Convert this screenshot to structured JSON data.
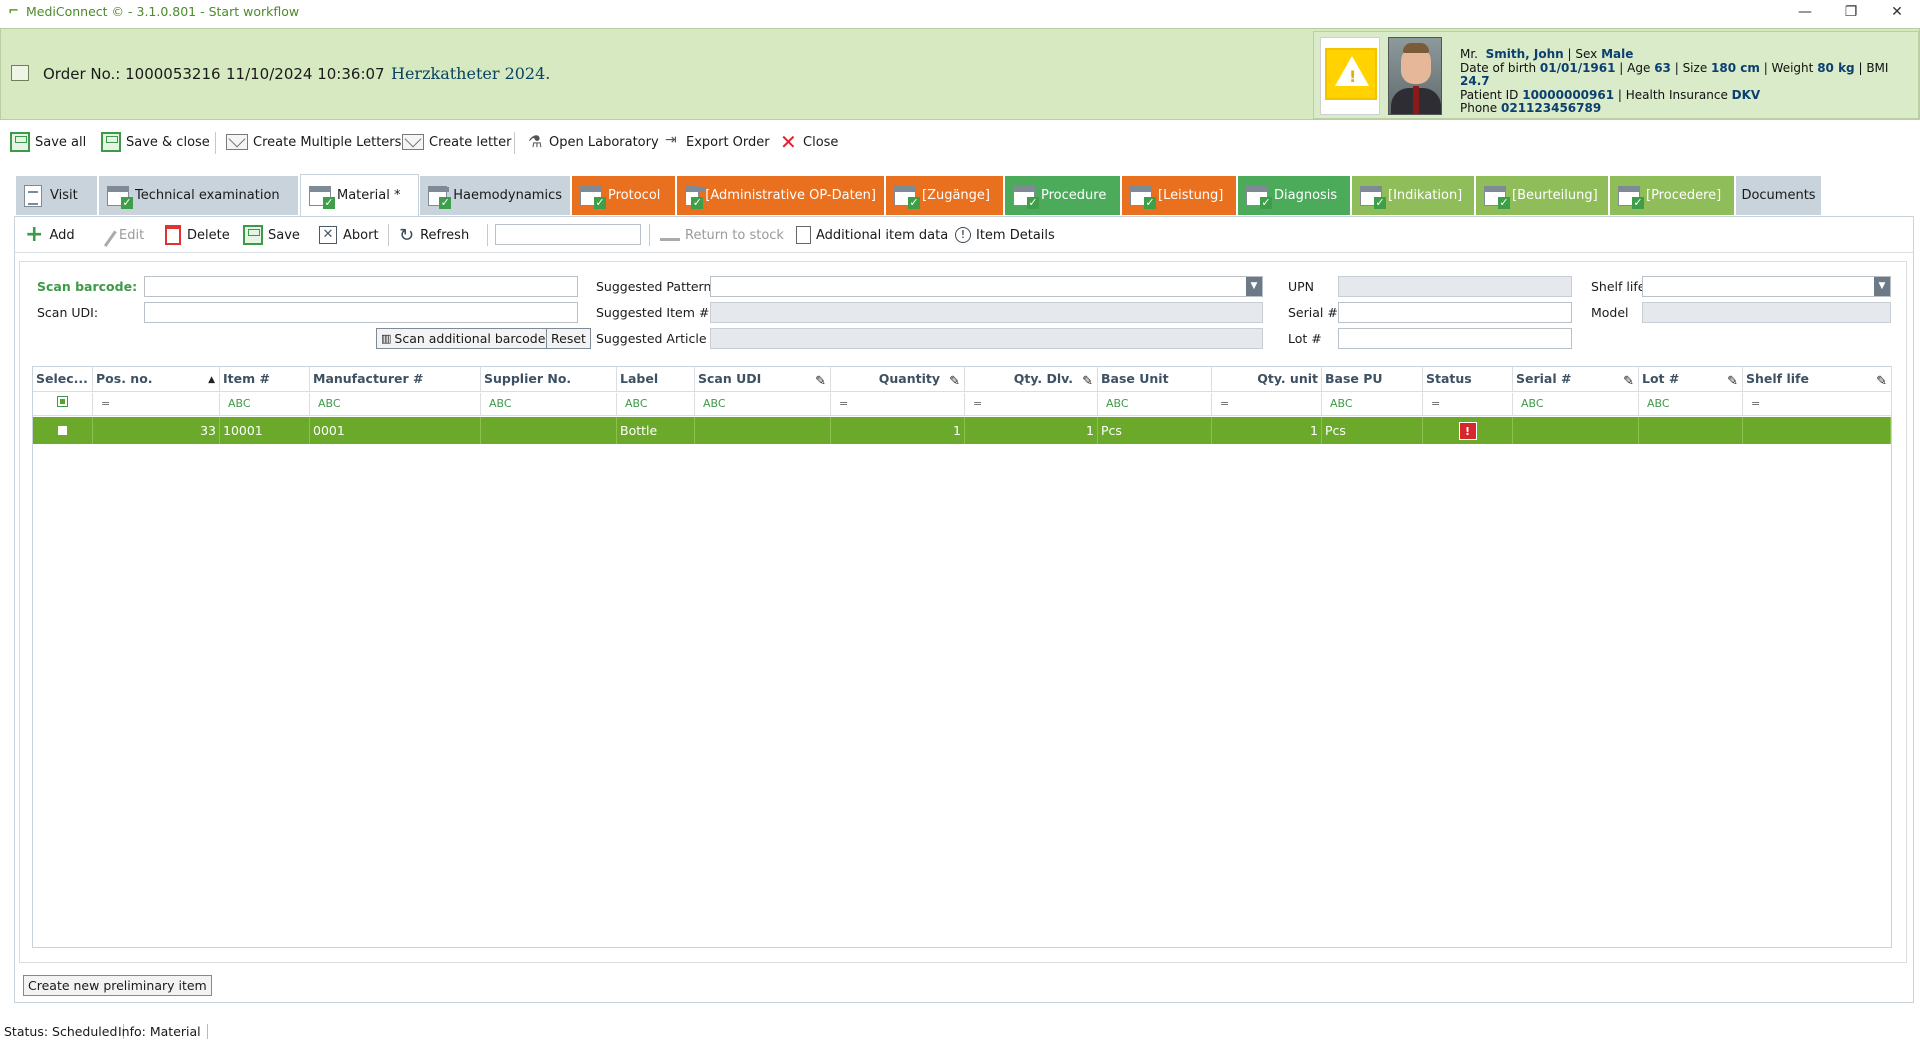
{
  "window": {
    "title": "MediConnect © - 3.1.0.801 - Start workflow",
    "controls": {
      "minimize": "—",
      "restore": "❐",
      "close": "✕"
    }
  },
  "header": {
    "order_label": "Order No.: 1000053216",
    "datetime": "11/10/2024 10:36:07",
    "workflow": "Herzkatheter 2024."
  },
  "patient": {
    "warning_icon": "warning-triangle-icon",
    "title": "Mr.",
    "name": "Smith, John",
    "sex_label": "Sex",
    "sex": "Male",
    "dob_label": "Date of birth",
    "dob": "01/01/1961",
    "age_label": "Age",
    "age": "63",
    "size_label": "Size",
    "size": "180 cm",
    "weight_label": "Weight",
    "weight": "80 kg",
    "bmi_label": "BMI",
    "bmi": "24.7",
    "pid_label": "Patient ID",
    "pid": "10000000961",
    "insurance_label": "Health Insurance",
    "insurance": "DKV",
    "phone_label": "Phone",
    "phone": "021123456789"
  },
  "toolbar": {
    "save_all": "Save all",
    "save_close": "Save & close",
    "create_multiple_letters": "Create Multiple Letters",
    "create_letter": "Create letter",
    "open_laboratory": "Open Laboratory",
    "export_order": "Export Order",
    "close": "Close"
  },
  "tabs": [
    {
      "label": "Visit",
      "style": "gray"
    },
    {
      "label": "Technical examination",
      "style": "gray"
    },
    {
      "label": "Material *",
      "style": "active"
    },
    {
      "label": "Haemodynamics",
      "style": "gray"
    },
    {
      "label": "Protocol",
      "style": "orange"
    },
    {
      "label": "[Administrative OP-Daten]",
      "style": "orange"
    },
    {
      "label": "[Zugänge]",
      "style": "orange"
    },
    {
      "label": "Procedure",
      "style": "green"
    },
    {
      "label": "[Leistung]",
      "style": "orange"
    },
    {
      "label": "Diagnosis",
      "style": "green"
    },
    {
      "label": "[Indikation]",
      "style": "olive"
    },
    {
      "label": "[Beurteilung]",
      "style": "olive"
    },
    {
      "label": "[Procedere]",
      "style": "olive"
    },
    {
      "label": "Documents",
      "style": "gray"
    }
  ],
  "subtoolbar": {
    "add": "Add",
    "edit": "Edit",
    "delete": "Delete",
    "save": "Save",
    "abort": "Abort",
    "refresh": "Refresh",
    "search_value": "",
    "return_to_stock": "Return to stock",
    "additional_item_data": "Additional item data",
    "item_details": "Item Details"
  },
  "form": {
    "scan_barcode_label": "Scan barcode:",
    "scan_udi_label": "Scan UDI:",
    "scan_additional_barcode": "Scan additional barcode",
    "reset": "Reset",
    "suggested_pattern_label": "Suggested Pattern",
    "suggested_item_label": "Suggested Item #",
    "suggested_article_label": "Suggested Article",
    "upn_label": "UPN",
    "serial_label": "Serial #",
    "lot_label": "Lot #",
    "shelf_life_label": "Shelf life",
    "model_label": "Model"
  },
  "grid": {
    "columns": [
      "Selec...",
      "Pos. no.",
      "Item #",
      "Manufacturer #",
      "Supplier No.",
      "Label",
      "Scan UDI",
      "Quantity",
      "Qty. Dlv.",
      "Base Unit",
      "Qty. unit",
      "Base PU",
      "Status",
      "Serial #",
      "Lot #",
      "Shelf life"
    ],
    "filters": [
      "",
      "=",
      "ABC",
      "ABC",
      "ABC",
      "ABC",
      "ABC",
      "=",
      "=",
      "ABC",
      "=",
      "ABC",
      "=",
      "ABC",
      "ABC",
      "="
    ],
    "rows": [
      {
        "selected": false,
        "pos": "33",
        "item": "10001",
        "manufacturer": "0001",
        "supplier": "",
        "label": "Bottle",
        "scan_udi": "",
        "quantity": "1",
        "qty_dlv": "1",
        "base_unit": "Pcs",
        "qty_unit": "1",
        "base_pu": "Pcs",
        "status": "warning",
        "serial": "",
        "lot": "",
        "shelf_life": ""
      }
    ]
  },
  "bottom": {
    "create_preliminary": "Create new preliminary item"
  },
  "statusbar": {
    "status": "Status: Scheduled",
    "info": "Info: Material"
  },
  "colors": {
    "header_bg": "#d6e9c1",
    "row_selected": "#6aa92a",
    "tab_orange": "#e8701e",
    "tab_green": "#4cab5a",
    "tab_olive": "#8fbd59",
    "tab_gray": "#c9d3dc"
  }
}
